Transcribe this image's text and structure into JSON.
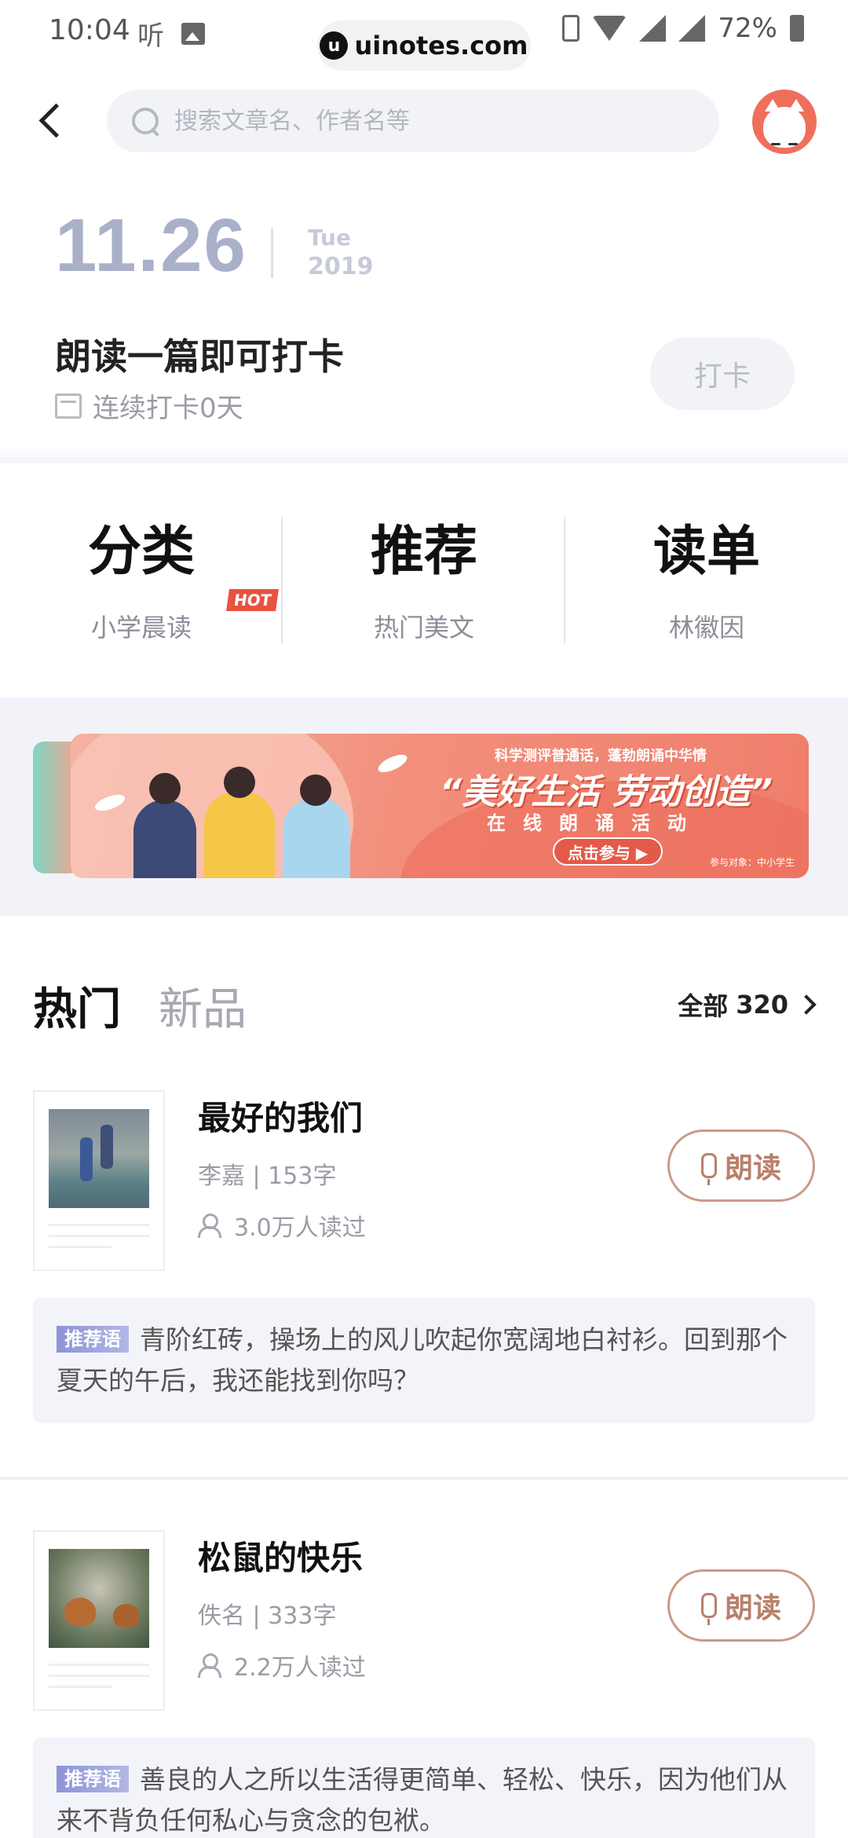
{
  "status_bar": {
    "time": "10:04",
    "app_glyph": "听",
    "battery": "72%",
    "url": "uinotes.com"
  },
  "search": {
    "placeholder": "搜索文章名、作者名等"
  },
  "date": {
    "day_month": "11.26",
    "weekday": "Tue",
    "year": "2019"
  },
  "checkin": {
    "title": "朗读一篇即可打卡",
    "streak": "连续打卡0天",
    "button": "打卡"
  },
  "categories": [
    {
      "title": "分类",
      "sub": "小学晨读",
      "badge": "HOT"
    },
    {
      "title": "推荐",
      "sub": "热门美文"
    },
    {
      "title": "读单",
      "sub": "林徽因"
    }
  ],
  "banner": {
    "top_line": "科学测评普通话，蓬勃朗诵中华情",
    "headline": "“美好生活 劳动创造”",
    "subline": "在线朗诵活动",
    "cta": "点击参与 ▶",
    "target": "参与对象：中小学生"
  },
  "tabs": {
    "hot": "热门",
    "new": "新品",
    "all_label": "全部",
    "all_count": "320"
  },
  "articles": [
    {
      "title": "最好的我们",
      "meta": "李嘉 | 153字",
      "reads": "3.0万人读过",
      "button": "朗读",
      "rec_tag": "推荐语",
      "rec_text": "青阶红砖，操场上的风儿吹起你宽阔地白衬衫。回到那个夏天的午后，我还能找到你吗？"
    },
    {
      "title": "松鼠的快乐",
      "meta": "佚名 | 333字",
      "reads": "2.2万人读过",
      "button": "朗读",
      "rec_tag": "推荐语",
      "rec_text": "善良的人之所以生活得更简单、轻松、快乐，因为他们从来不背负任何私心与贪念的包袱。"
    }
  ],
  "colors": {
    "accent_read": "#b8806b",
    "date": "#a9b0c8",
    "hot_badge": "#e8533f",
    "banner": "#ef7e6b"
  }
}
